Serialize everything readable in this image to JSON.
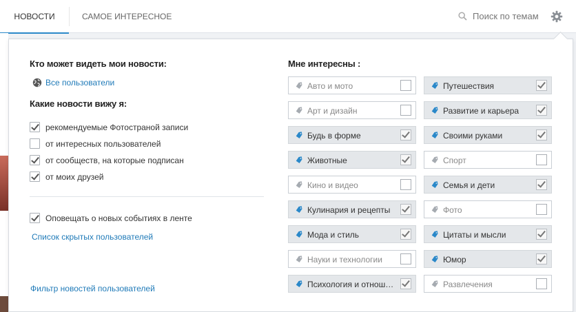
{
  "nav": {
    "tabs": [
      {
        "label": "Новости",
        "active": true
      },
      {
        "label": "Самое интересное",
        "active": false
      }
    ],
    "search_label": "Поиск по темам"
  },
  "settings": {
    "who_sees_title": "Кто может видеть мои новости:",
    "who_sees_value": "Все пользователи",
    "which_news_title": "Какие новости вижу я:",
    "news_options": [
      {
        "label": "рекомендуемые Фотостраной записи",
        "checked": true
      },
      {
        "label": "от интересных пользователей",
        "checked": false
      },
      {
        "label": "от сообществ, на которые подписан",
        "checked": true
      },
      {
        "label": "от моих друзей",
        "checked": true
      }
    ],
    "notify": {
      "label": "Оповещать о новых событиях в ленте",
      "checked": true
    },
    "hidden_users_link": "Список скрытых пользователей",
    "filter_link": "Фильтр новостей пользователей",
    "interests_title": "Мне интересны :",
    "interests": [
      {
        "label": "Авто и мото",
        "checked": false
      },
      {
        "label": "Путешествия",
        "checked": true
      },
      {
        "label": "Арт и дизайн",
        "checked": false
      },
      {
        "label": "Развитие и карьера",
        "checked": true
      },
      {
        "label": "Будь в форме",
        "checked": true
      },
      {
        "label": "Своими руками",
        "checked": true
      },
      {
        "label": "Животные",
        "checked": true
      },
      {
        "label": "Спорт",
        "checked": false
      },
      {
        "label": "Кино и видео",
        "checked": false
      },
      {
        "label": "Семья и дети",
        "checked": true
      },
      {
        "label": "Кулинария и рецепты",
        "checked": true
      },
      {
        "label": "Фото",
        "checked": false
      },
      {
        "label": "Мода и стиль",
        "checked": true
      },
      {
        "label": "Цитаты и мысли",
        "checked": true
      },
      {
        "label": "Науки и технологии",
        "checked": false
      },
      {
        "label": "Юмор",
        "checked": true
      },
      {
        "label": "Психология и отнош…",
        "checked": true
      },
      {
        "label": "Развлечения",
        "checked": false
      }
    ]
  },
  "colors": {
    "accent": "#2a88c9",
    "link": "#1f7ab8",
    "tag_checked_bg": "#e4e7ea",
    "tag_icon_on": "#2a88c9",
    "tag_icon_off": "#a6abb1"
  },
  "icons": {
    "search": "search-icon",
    "settings": "gear-icon",
    "visibility": "globe-icon",
    "tag": "tag-icon"
  }
}
